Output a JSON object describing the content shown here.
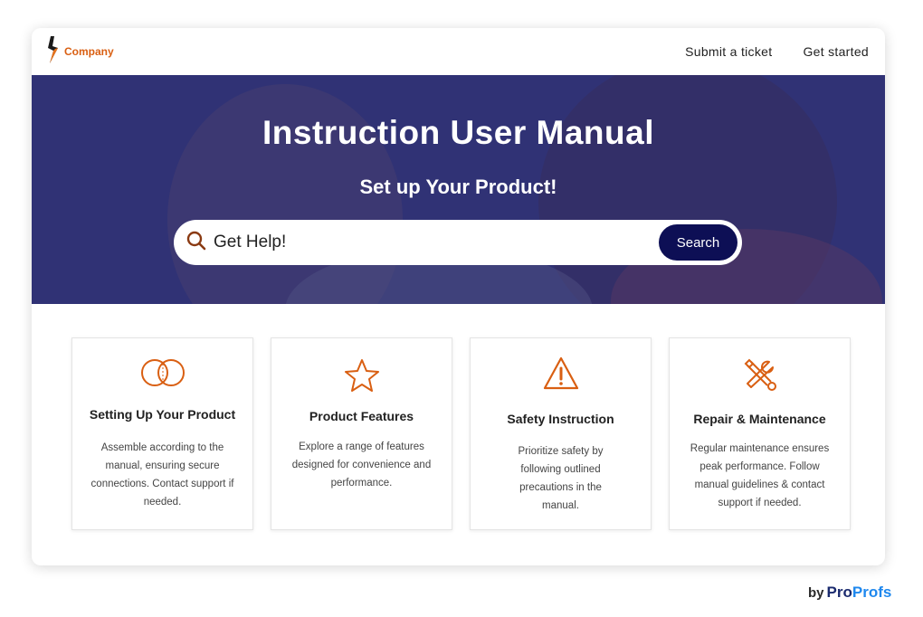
{
  "header": {
    "logo_text": "Company",
    "nav": [
      {
        "label": "Submit a ticket"
      },
      {
        "label": "Get started"
      }
    ]
  },
  "hero": {
    "title": "Instruction User Manual",
    "subtitle": "Set up Your Product!",
    "search": {
      "placeholder": "Get Help!",
      "button_label": "Search"
    }
  },
  "cards": [
    {
      "icon": "rings-icon",
      "title": "Setting Up Your Product",
      "body": "Assemble according to the manual, ensuring secure connections. Contact support if needed."
    },
    {
      "icon": "star-icon",
      "title": "Product Features",
      "body": "Explore a range of features designed for convenience and performance."
    },
    {
      "icon": "warning-icon",
      "title": "Safety Instruction",
      "body": "Prioritize safety by following outlined precautions in the manual."
    },
    {
      "icon": "tools-icon",
      "title": "Repair & Maintenance",
      "body": "Regular maintenance ensures peak performance. Follow manual guidelines & contact support if needed."
    }
  ],
  "footer": {
    "by": "by",
    "brand_pro": "Pro",
    "brand_profs": "Profs"
  },
  "colors": {
    "accent": "#d95f12",
    "hero_overlay": "#3d3f7e",
    "search_button": "#0d0f55",
    "brand_dark": "#1a2a6e",
    "brand_light": "#1f88ee"
  }
}
